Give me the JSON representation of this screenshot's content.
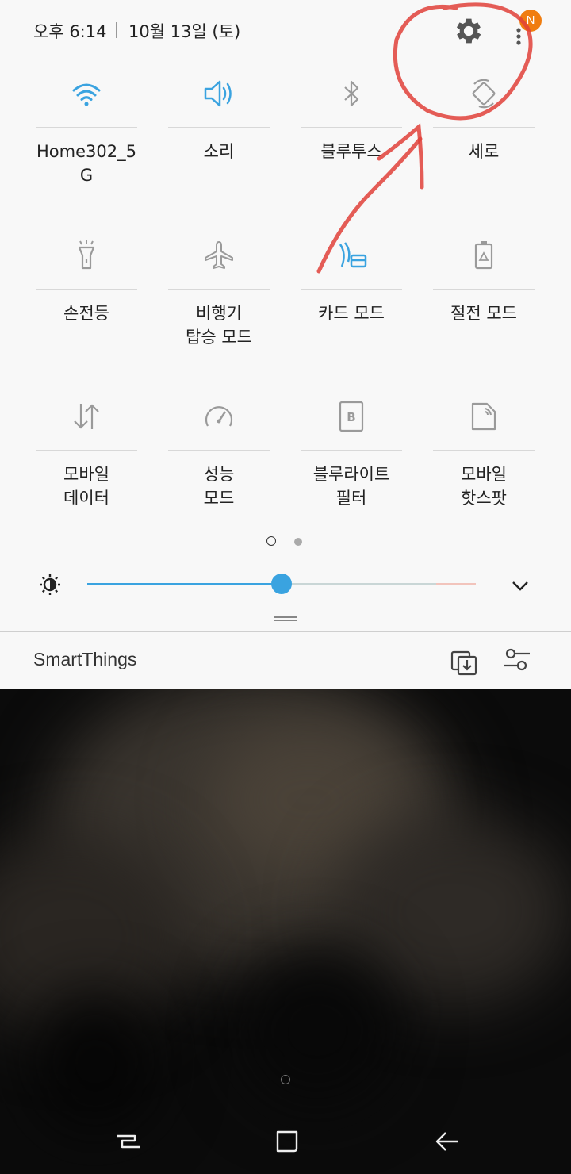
{
  "status": {
    "time": "오후 6:14",
    "date": "10월 13일 (토)",
    "badge": "N"
  },
  "tiles": [
    {
      "label": "Home302_5\nG",
      "icon": "wifi-icon",
      "active": true
    },
    {
      "label": "소리",
      "icon": "volume-icon",
      "active": true
    },
    {
      "label": "블루투스",
      "icon": "bluetooth-icon",
      "active": false
    },
    {
      "label": "세로",
      "icon": "rotate-icon",
      "active": false
    },
    {
      "label": "손전등",
      "icon": "flashlight-icon",
      "active": false
    },
    {
      "label": "비행기\n탑승 모드",
      "icon": "airplane-icon",
      "active": false
    },
    {
      "label": "카드 모드",
      "icon": "card-mode-icon",
      "active": true
    },
    {
      "label": "절전 모드",
      "icon": "battery-saver-icon",
      "active": false
    },
    {
      "label": "모바일\n데이터",
      "icon": "mobile-data-icon",
      "active": false
    },
    {
      "label": "성능\n모드",
      "icon": "performance-icon",
      "active": false
    },
    {
      "label": "블루라이트\n필터",
      "icon": "blue-light-icon",
      "active": false
    },
    {
      "label": "모바일\n핫스팟",
      "icon": "hotspot-icon",
      "active": false
    }
  ],
  "page_indicator": {
    "current": 1,
    "total": 2
  },
  "brightness": {
    "level": 0.5
  },
  "smartthings": {
    "label": "SmartThings"
  },
  "colors": {
    "accent": "#3aa3e0",
    "badge": "#f07d10",
    "annotation": "#e0413a",
    "inactive_icon": "#9a9a9a"
  }
}
